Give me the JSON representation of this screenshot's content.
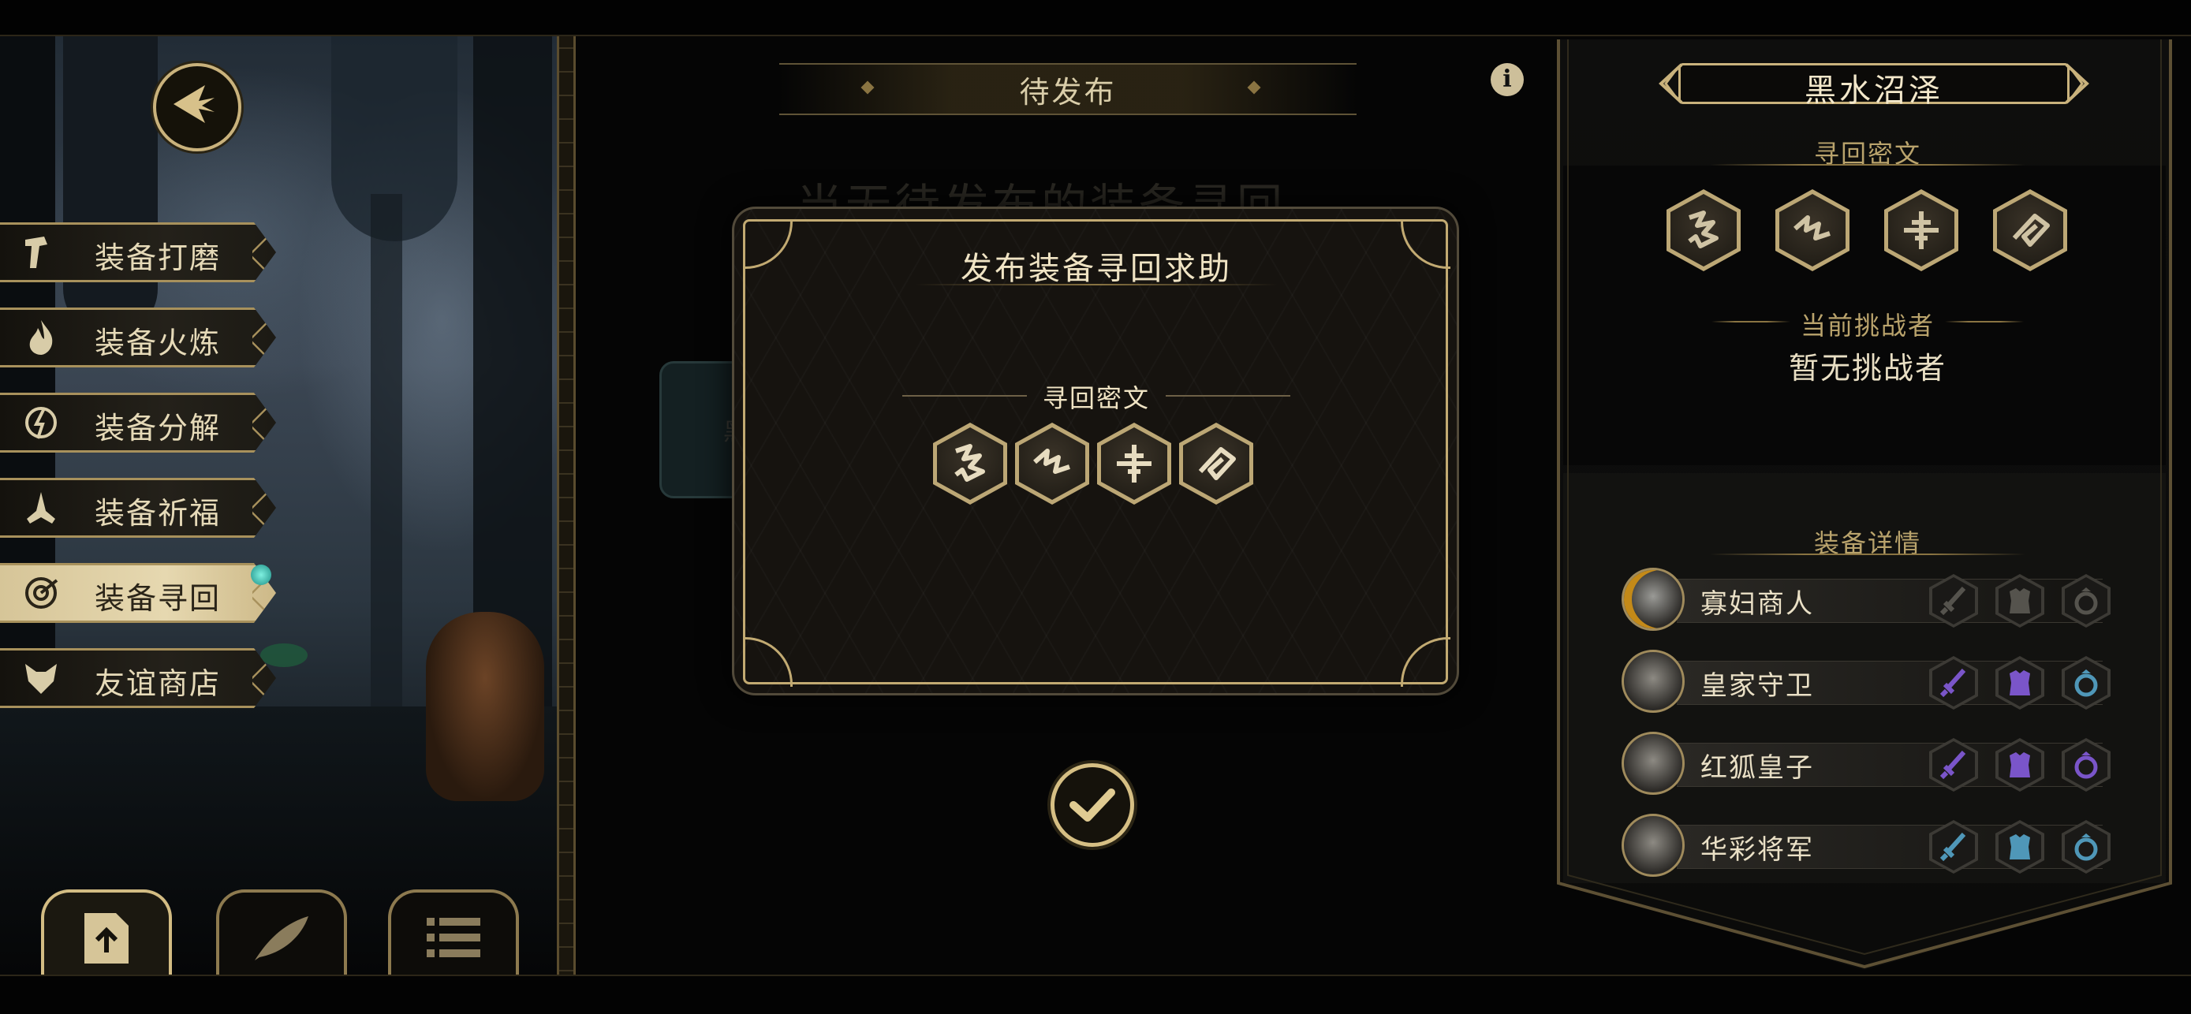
{
  "left_menu": {
    "items": [
      {
        "label": "装备打磨",
        "icon": "hammer-icon",
        "active": false
      },
      {
        "label": "装备火炼",
        "icon": "flame-icon",
        "active": false
      },
      {
        "label": "装备分解",
        "icon": "disassemble-icon",
        "active": false
      },
      {
        "label": "装备祈福",
        "icon": "praying-hands-icon",
        "active": false
      },
      {
        "label": "装备寻回",
        "icon": "target-icon",
        "active": true
      },
      {
        "label": "友谊商店",
        "icon": "fox-icon",
        "active": false
      }
    ]
  },
  "bottom_tabs": [
    {
      "icon": "upload-document-icon",
      "active": true
    },
    {
      "icon": "feather-icon",
      "active": false
    },
    {
      "icon": "list-icon",
      "active": false
    }
  ],
  "center": {
    "title": "待发布",
    "background_text": "当无待发布的装备寻回",
    "background_card_text": "黑"
  },
  "dialog": {
    "title": "发布装备寻回求助",
    "subheading": "寻回密文",
    "glyph_icons": [
      "rune-1-icon",
      "rune-2-icon",
      "rune-3-icon",
      "rune-4-icon"
    ]
  },
  "right_panel": {
    "region_name": "黑水沼泽",
    "cipher_heading": "寻回密文",
    "cipher_glyph_icons": [
      "rune-1-icon",
      "rune-2-icon",
      "rune-3-icon",
      "rune-4-icon"
    ],
    "challenger_heading": "当前挑战者",
    "challenger_value": "暂无挑战者",
    "equipment_heading": "装备详情",
    "rows": [
      {
        "name": "寡妇商人",
        "equipment_color": "#6a6760",
        "dimmed": true
      },
      {
        "name": "皇家守卫",
        "equipment_color": "#7a55c9",
        "dimmed": false
      },
      {
        "name": "红狐皇子",
        "equipment_color": "#7a55c9",
        "dimmed": false
      },
      {
        "name": "华彩将军",
        "equipment_color": "#4f97b8",
        "dimmed": false
      }
    ]
  },
  "colors": {
    "gold": "#c9b27c",
    "purple_rarity": "#7a55c9",
    "blue_rarity": "#4f97b8"
  }
}
